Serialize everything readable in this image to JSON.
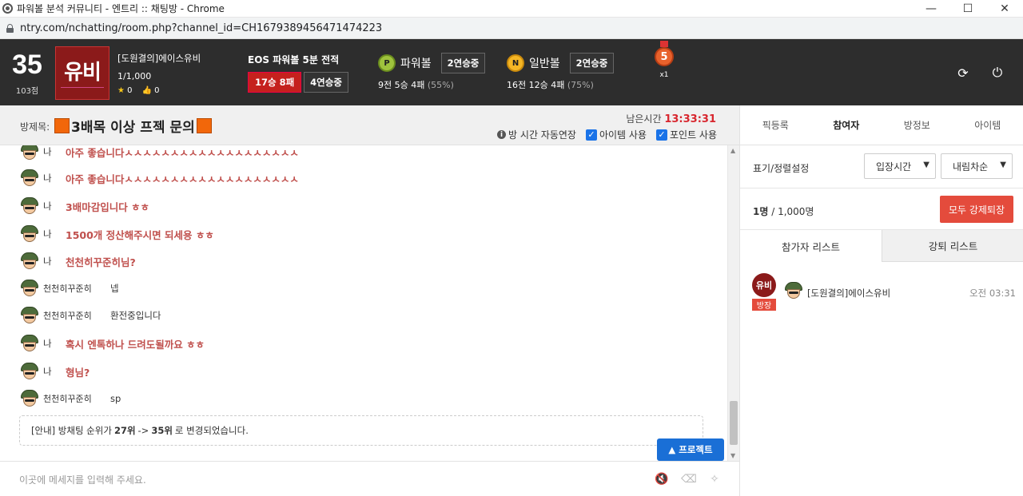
{
  "browser": {
    "title": "파워볼 분석 커뮤니티 - 엔트리 :: 채팅방 - Chrome",
    "url": "ntry.com/nchatting/room.php?channel_id=CH1679389456471474223"
  },
  "header": {
    "level": "35",
    "points": "103점",
    "logo_text": "유비",
    "profile_name": "[도원결의]에이스유비",
    "member_count": "1/1,000",
    "stars": "0",
    "likes": "0",
    "eos_title": "EOS 파워볼 5분 전적",
    "eos_record": "17승 8패",
    "eos_streak": "4연승중",
    "powerball": {
      "coin": "P",
      "name": "파워볼",
      "streak": "2연승중",
      "stat": "9전 5승 4패",
      "pct": "(55%)"
    },
    "normalball": {
      "coin": "N",
      "name": "일반볼",
      "streak": "2연승중",
      "stat": "16전 12승 4패",
      "pct": "(75%)"
    },
    "medal_num": "5",
    "medal_count": "x1",
    "refresh_icon": "⟳",
    "power_icon": "⏻"
  },
  "room": {
    "label": "방제목:",
    "title": "3배목 이상 프젝 문의",
    "remain_label": "남은시간",
    "remain_time": "13:33:31",
    "opt_autoextend": "방 시간 자동연장",
    "opt_item": "아이템 사용",
    "opt_point": "포인트 사용"
  },
  "right_tabs": [
    "픽등록",
    "참여자",
    "방정보",
    "아이템"
  ],
  "messages": [
    {
      "type": "me",
      "who": "나",
      "text": "아주 좋습니다ㅅㅅㅅㅅㅅㅅㅅㅅㅅㅅㅅㅅㅅㅅㅅㅅㅅㅅㅅ"
    },
    {
      "type": "me",
      "who": "나",
      "text": "아주 좋습니다ㅅㅅㅅㅅㅅㅅㅅㅅㅅㅅㅅㅅㅅㅅㅅㅅㅅㅅㅅ"
    },
    {
      "type": "me",
      "who": "나",
      "text": "3배마감입니다 ㅎㅎ"
    },
    {
      "type": "me",
      "who": "나",
      "text": "1500개 정산해주시면 되세용 ㅎㅎ"
    },
    {
      "type": "me",
      "who": "나",
      "text": "천천히꾸준히님?"
    },
    {
      "type": "other",
      "who": "천천히꾸준히",
      "text": "넵"
    },
    {
      "type": "other",
      "who": "천천히꾸준히",
      "text": "환전중입니다"
    },
    {
      "type": "me",
      "who": "나",
      "text": "혹시 엔톡하나 드려도될까요 ㅎㅎ"
    },
    {
      "type": "me",
      "who": "나",
      "text": "형님?"
    },
    {
      "type": "other",
      "who": "천천히꾸준히",
      "text": "sp"
    }
  ],
  "notice": {
    "prefix": "[안내] 방채팅 순위가",
    "from": "27위",
    "arrow": "->",
    "to": "35위",
    "suffix": "로 변경되었습니다."
  },
  "protect_button": "▲ 프로젝트",
  "input": {
    "placeholder": "이곳에 메세지를 입력해 주세요."
  },
  "panel": {
    "sort_label": "표기/정렬설정",
    "sort_field": "입장시간",
    "sort_order": "내림차순",
    "count_current": "1명",
    "count_sep": " / ",
    "count_max": "1,000명",
    "kick_all": "모두 강제퇴장",
    "tab_participants": "참가자 리스트",
    "tab_kicked": "강퇴 리스트",
    "member": {
      "logo": "유비",
      "badge": "방장",
      "name": "[도원결의]에이스유비",
      "time": "오전 03:31"
    }
  },
  "colors": {
    "header_bg": "#2d2d2d",
    "accent_red": "#c5211d",
    "me_text": "#c0504d",
    "protect_blue": "#1a6fd6"
  }
}
